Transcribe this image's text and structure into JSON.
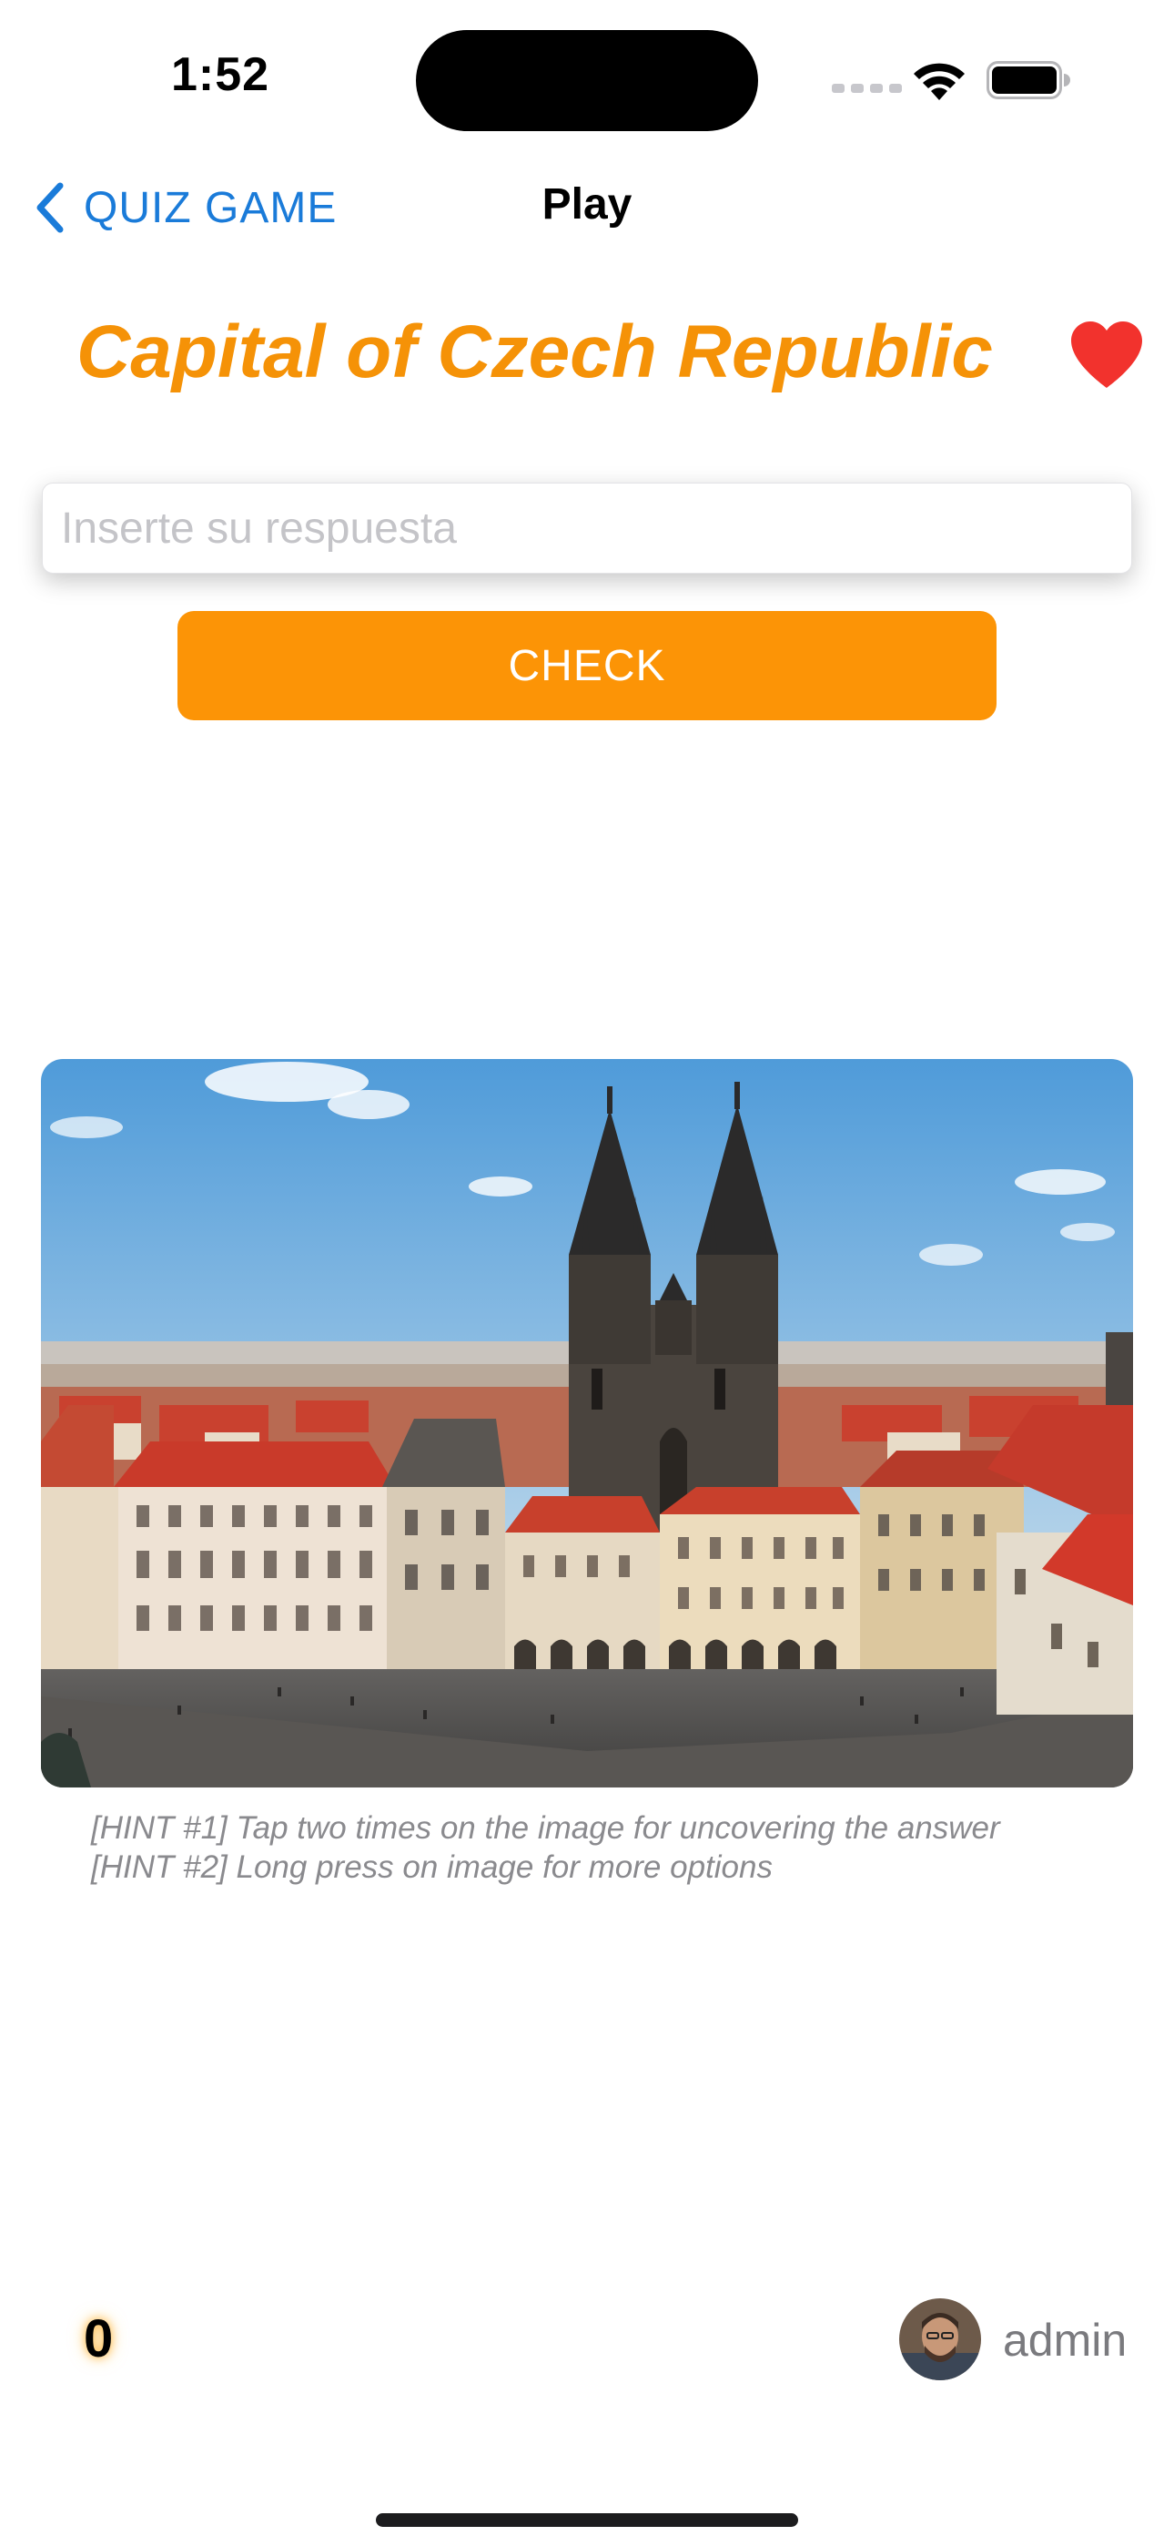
{
  "status_bar": {
    "time": "1:52"
  },
  "nav": {
    "back_label": "QUIZ GAME",
    "title": "Play"
  },
  "question": {
    "title": "Capital of Czech Republic"
  },
  "answer": {
    "placeholder": "Inserte su respuesta",
    "value": ""
  },
  "check_button": {
    "label": "CHECK"
  },
  "hints": {
    "hint1": "[HINT #1] Tap two times on the image for uncovering the answer",
    "hint2": "[HINT #2] Long press on image for more options"
  },
  "footer": {
    "score": "0",
    "username": "admin"
  },
  "colors": {
    "accent_orange": "#f59207",
    "button_orange": "#fc9406",
    "link_blue": "#1a7bd9",
    "heart_red": "#f2322d"
  },
  "icons": {
    "back": "chevron-left-icon",
    "favorite": "heart-icon",
    "wifi": "wifi-icon",
    "battery": "battery-icon",
    "signal": "signal-icon"
  }
}
